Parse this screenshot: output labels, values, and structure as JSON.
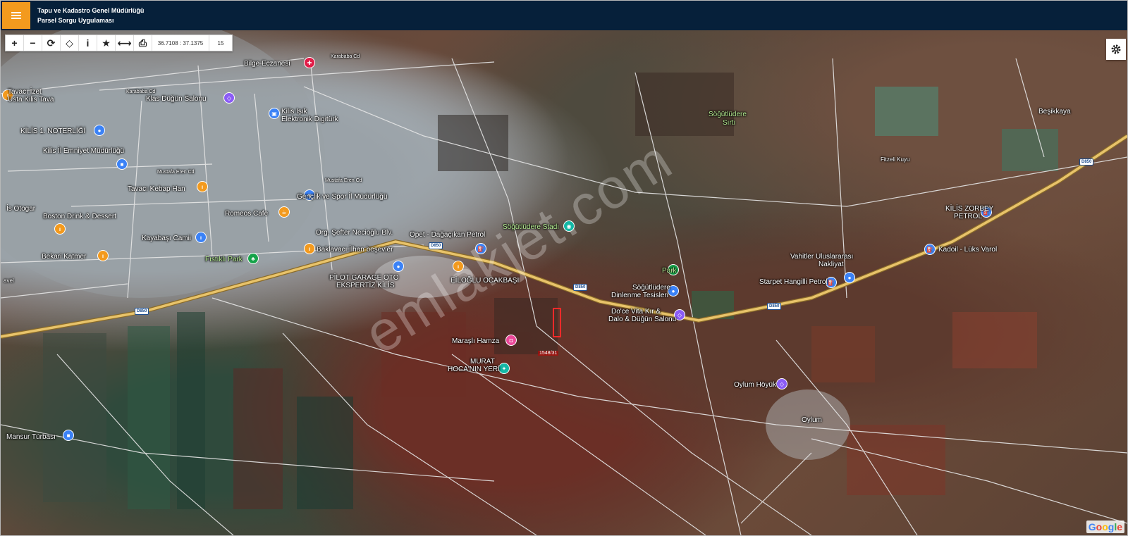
{
  "header": {
    "title_line1": "Tapu ve Kadastro Genel Müdürlüğü",
    "title_line2": "Parsel Sorgu Uygulaması",
    "menu_icon": "hamburger-menu-icon"
  },
  "colors": {
    "header_bg": "#06203a",
    "menu_accent": "#f39a1e",
    "road_highway": "#e8c36a",
    "poi_orange": "#f39a1e",
    "poi_blue": "#3b82f6",
    "poi_purple": "#8b5cf6",
    "poi_green": "#16a34a",
    "poi_teal": "#14b8a6",
    "poi_pink": "#ec4899",
    "poi_red": "#e11d48"
  },
  "toolbar": {
    "zoom_in": "+",
    "zoom_out": "−",
    "refresh": "⟳",
    "locate": "◇",
    "info": "i",
    "favorite": "★",
    "measure": "⟷",
    "print": "⎙",
    "coordinates": "36.7108 : 37.1375",
    "zoom_level": "15"
  },
  "map": {
    "attribution": "Google",
    "watermark": "emlakjet.com",
    "parcel_label": "1548/31",
    "road_shield": "D850",
    "labels": {
      "bilge_eczanesi": "Bilge Eczanesi",
      "karababa_cd_1": "Karababa Cd",
      "karababa_cd_2": "Karababa Cd",
      "tavaci_izet": "Tavacı İzet",
      "usta_kilis_tava": "Usta Kilis Tava",
      "klas_dugun": "Klas Düğün Salonu",
      "kilis_isik": "Kilis Işık",
      "elektronik": "Elektronik Digitürk",
      "kilis_noterligi": "KİLİS 1. NOTERLİĞİ",
      "emniyet": "Kilis İl Emniyet Müdürlüğü",
      "mustafa_eren_1": "Mustafa Eren Cd",
      "mustafa_eren_2": "Mustafa Eren Cd",
      "tavaci_kebap": "Tavacı Kebap Han",
      "genclik": "Gençlik ve Spor İl Müdürlüğü",
      "is_otogar": "İs Otogar",
      "boston": "Boston Drink & Dessert",
      "romeos": "Romeos Cafe",
      "kayabasi": "Kayabaşı Camii",
      "orgeneral": "Org. Şefter Necioğlu Blv.",
      "opet": "Opet - Dağaçıkan Petrol",
      "bekari": "Bekari Katmer",
      "fistikli": "Fıstıklı Park",
      "baklavaci": "Baklavacı İlhan beşevler",
      "sogutludere_stadi": "Söğütlüdere Stadı",
      "sogutludere_sirti_1": "Söğütlüdere",
      "sogutludere_sirti_2": "Sırtı",
      "besikkaya": "Beşikkaya",
      "fitzeli": "Fitzeli Kuyu",
      "zorbey_1": "KİLİS ZORBEY",
      "zorbey_2": "PETROL",
      "kadoil": "Kadoil - Lüks Varol",
      "vahitler_1": "Vahitler Uluslararası",
      "vahitler_2": "Nakliyat",
      "starpet": "Starpet Hangilli Petrol",
      "park": "Park",
      "sogutludere_tes_1": "Söğütlüdere",
      "sogutludere_tes_2": "Dinlenme Tesisleri",
      "docevita_1": "Do'ce Vita Kır &",
      "docevita_2": "Dalo & Düğün Salonu",
      "pilot_1": "PİLOT GARAGE OTO",
      "pilot_2": "EKSPERTİZ KİLİS",
      "ocakbasi": "EİLOĞLU OCAKBAŞI",
      "marasli": "Maraşlı Hamza",
      "murat_1": "MURAT",
      "murat_2": "HOCA'NIN YERİ",
      "oylum_hoyuk": "Oylum Höyük",
      "oylum": "Oylum",
      "mansur": "Mansur Türbası",
      "avel": "avel"
    }
  }
}
